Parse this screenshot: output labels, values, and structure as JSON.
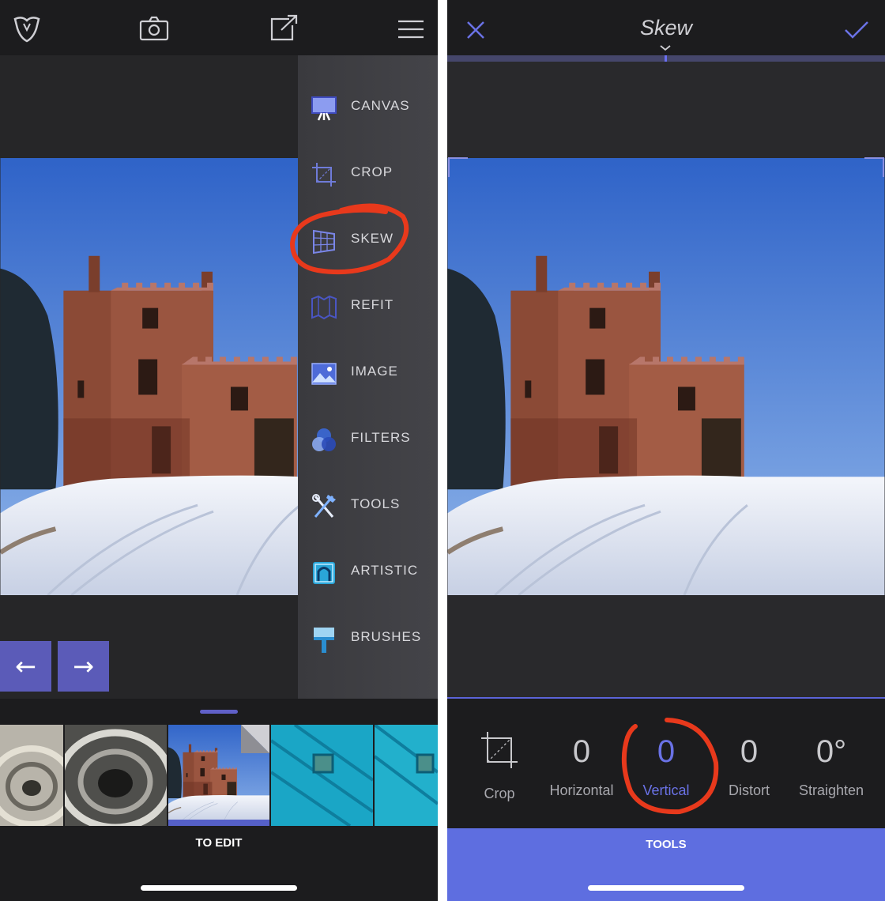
{
  "left_panel": {
    "top_bar": {
      "icons": [
        "app-logo-icon",
        "camera-icon",
        "share-icon",
        "hamburger-menu-icon"
      ]
    },
    "side_menu": {
      "items": [
        {
          "label": "CANVAS",
          "icon": "canvas-icon"
        },
        {
          "label": "CROP",
          "icon": "crop-icon"
        },
        {
          "label": "SKEW",
          "icon": "skew-icon"
        },
        {
          "label": "REFIT",
          "icon": "refit-icon"
        },
        {
          "label": "IMAGE",
          "icon": "image-icon"
        },
        {
          "label": "FILTERS",
          "icon": "filters-icon"
        },
        {
          "label": "TOOLS",
          "icon": "tools-icon"
        },
        {
          "label": "ARTISTIC",
          "icon": "artistic-icon"
        },
        {
          "label": "BRUSHES",
          "icon": "brushes-icon"
        }
      ],
      "highlighted_item": "SKEW"
    },
    "nav": {
      "back_glyph": "←",
      "forward_glyph": "→"
    },
    "tray": {
      "label": "TO EDIT",
      "thumbnails": [
        "parking-spiral-1",
        "parking-spiral-2",
        "castle-snow",
        "blue-door-1",
        "blue-door-2"
      ]
    }
  },
  "right_panel": {
    "header": {
      "title": "Skew",
      "cancel_icon": "close-icon",
      "confirm_icon": "checkmark-icon"
    },
    "controls": [
      {
        "value": "",
        "label": "Crop",
        "icon": "crop-icon"
      },
      {
        "value": "0",
        "label": "Horizontal"
      },
      {
        "value": "0",
        "label": "Vertical",
        "active": true
      },
      {
        "value": "0",
        "label": "Distort"
      },
      {
        "value": "0°",
        "label": "Straighten"
      }
    ],
    "bottom_bar": {
      "label": "TOOLS"
    }
  },
  "colors": {
    "accent": "#5e6ee0",
    "annotation": "#e8391c",
    "dark_bg": "#1c1c1e"
  }
}
